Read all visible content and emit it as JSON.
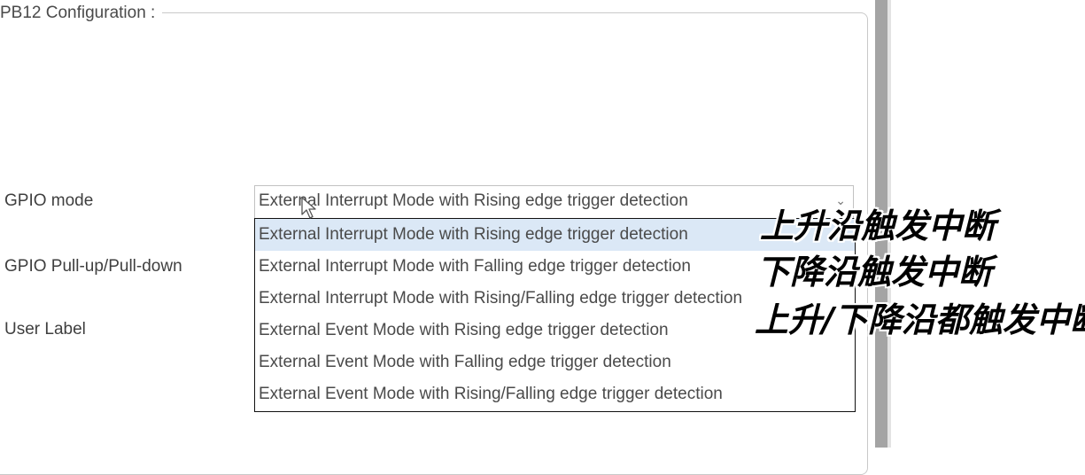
{
  "panel": {
    "title": "PB12 Configuration :"
  },
  "fields": {
    "gpio_mode_label": "GPIO mode",
    "pull_label": "GPIO Pull-up/Pull-down",
    "user_label_label": "User Label"
  },
  "gpio_mode": {
    "selected_value": "External Interrupt Mode with Rising edge trigger detection",
    "options": [
      "External Interrupt Mode with Rising edge trigger detection",
      "External Interrupt Mode with Falling edge trigger detection",
      "External Interrupt Mode with Rising/Falling edge trigger detection",
      "External Event Mode with Rising edge trigger detection",
      "External Event Mode with Falling edge trigger detection",
      "External Event Mode with Rising/Falling edge trigger detection"
    ],
    "highlighted_index": 0,
    "highlight_color": "#dbe8f6"
  },
  "annotations": [
    "上升沿触发中断",
    "下降沿触发中断",
    "上升/下降沿都触发中断"
  ],
  "icons": {
    "dropdown_arrow": "chevron-down-icon",
    "cursor": "mouse-pointer-icon"
  }
}
